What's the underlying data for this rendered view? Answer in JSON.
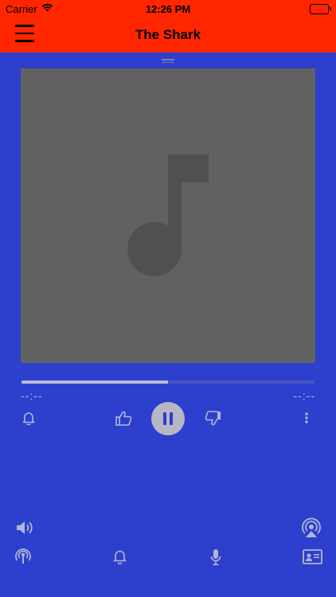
{
  "status_bar": {
    "carrier": "Carrier",
    "time": "12:26 PM",
    "wifi_icon": "wifi-icon",
    "battery_icon": "battery-icon"
  },
  "header": {
    "title": "The Shark",
    "menu_icon": "hamburger-menu-icon",
    "background_color": "#ff2600"
  },
  "player": {
    "artwork_icon": "music-note-icon",
    "progress": 0.5,
    "elapsed": "--:--",
    "remaining": "--:--",
    "controls": {
      "alarm_icon": "bell-icon",
      "like_icon": "thumbs-up-icon",
      "play_pause_icon": "pause-icon",
      "dislike_icon": "thumbs-down-icon",
      "more_icon": "more-vertical-icon"
    }
  },
  "bottom_bar": {
    "volume_icon": "volume-icon",
    "airplay_icon": "airplay-icon",
    "podcast_icon": "podcast-icon",
    "notification_icon": "bell-icon",
    "microphone_icon": "microphone-icon",
    "contact_card_icon": "contact-card-icon"
  },
  "colors": {
    "background": "#2d3fcd",
    "header": "#ff2600",
    "artwork_bg": "#616161",
    "icon": "#b3b6d3"
  }
}
